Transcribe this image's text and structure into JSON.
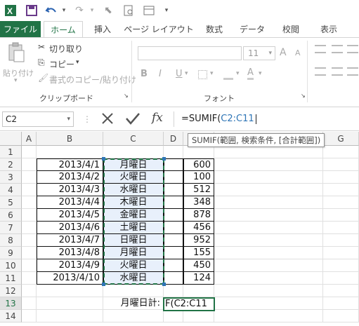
{
  "ribbon_tabs": {
    "file": "ファイル",
    "home": "ホーム",
    "insert": "挿入",
    "page_layout": "ページ レイアウト",
    "formulas": "数式",
    "data": "データ",
    "review": "校閲",
    "view": "表示"
  },
  "clipboard": {
    "paste": "貼り付け",
    "cut": "切り取り",
    "copy": "コピー",
    "format_painter": "書式のコピー/貼り付け",
    "group_label": "クリップボード"
  },
  "font": {
    "size": "11",
    "group_label": "フォント",
    "bold": "B",
    "italic": "I",
    "underline": "U",
    "grow": "A",
    "shrink": "A"
  },
  "formula_bar": {
    "name_box": "C2",
    "formula_prefix": "=SUMIF(",
    "formula_ref": "C2:C11",
    "fx": "fx",
    "tooltip": "SUMIF(範囲, 検索条件, [合計範囲])"
  },
  "columns": [
    "A",
    "B",
    "C",
    "D",
    "E",
    "F",
    "G"
  ],
  "rows": [
    "1",
    "2",
    "3",
    "4",
    "5",
    "6",
    "7",
    "8",
    "9",
    "10",
    "11",
    "12",
    "13",
    "14"
  ],
  "table": [
    {
      "date": "2013/4/1",
      "day": "月曜日",
      "value": "600"
    },
    {
      "date": "2013/4/2",
      "day": "火曜日",
      "value": "100"
    },
    {
      "date": "2013/4/3",
      "day": "水曜日",
      "value": "512"
    },
    {
      "date": "2013/4/4",
      "day": "木曜日",
      "value": "348"
    },
    {
      "date": "2013/4/5",
      "day": "金曜日",
      "value": "878"
    },
    {
      "date": "2013/4/6",
      "day": "土曜日",
      "value": "456"
    },
    {
      "date": "2013/4/7",
      "day": "日曜日",
      "value": "952"
    },
    {
      "date": "2013/4/8",
      "day": "月曜日",
      "value": "155"
    },
    {
      "date": "2013/4/9",
      "day": "火曜日",
      "value": "450"
    },
    {
      "date": "2013/4/10",
      "day": "水曜日",
      "value": "124"
    }
  ],
  "summary": {
    "label": "月曜日計:",
    "edit_prefix": "F(",
    "edit_ref": "C2:C11"
  },
  "colors": {
    "excel_green": "#217346",
    "ref_blue": "#2e75b6",
    "selection_fill": "#e8f0fb"
  }
}
